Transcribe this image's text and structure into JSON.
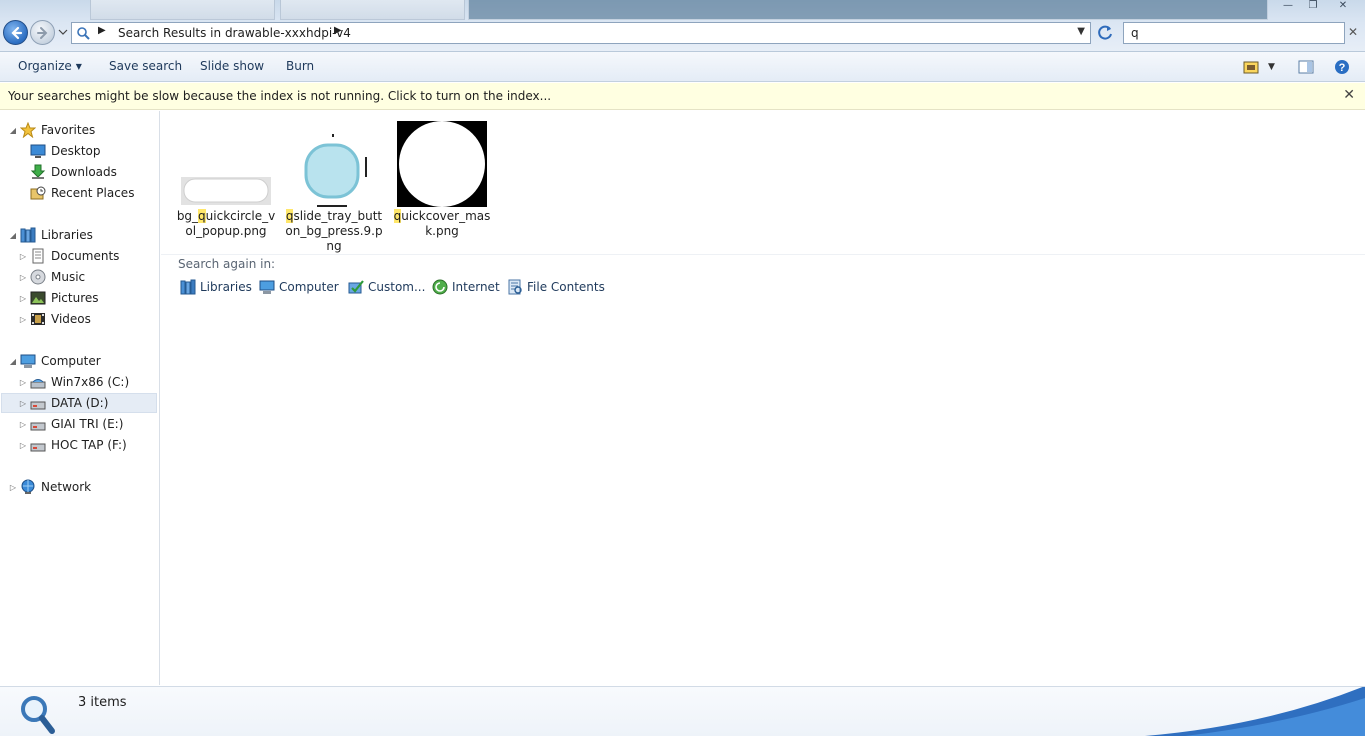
{
  "window": {
    "min_glyph": "—",
    "max_glyph": "❐",
    "close_glyph": "✕"
  },
  "address": {
    "breadcrumb": "Search Results in drawable-xxxhdpi-v4",
    "sep": "▶",
    "search_value": "q",
    "clear_glyph": "✕"
  },
  "toolbar": {
    "organize": "Organize",
    "save_search": "Save search",
    "slide_show": "Slide show",
    "burn": "Burn"
  },
  "infobar": {
    "message": "Your searches might be slow because the index is not running.  Click to turn on the index...",
    "close_glyph": "✕"
  },
  "nav": {
    "favorites": "Favorites",
    "desktop": "Desktop",
    "downloads": "Downloads",
    "recent_places": "Recent Places",
    "libraries": "Libraries",
    "documents": "Documents",
    "music": "Music",
    "pictures": "Pictures",
    "videos": "Videos",
    "computer": "Computer",
    "drive_c": "Win7x86 (C:)",
    "drive_d": "DATA (D:)",
    "drive_e": "GIAI TRI (E:)",
    "drive_f": "HOC TAP (F:)",
    "network": "Network"
  },
  "files": [
    {
      "pre": "bg_",
      "hl": "q",
      "post": "uickcircle_vol_popup.png"
    },
    {
      "pre": "",
      "hl": "q",
      "post": "slide_tray_button_bg_press.9.png"
    },
    {
      "pre": "",
      "hl": "q",
      "post": "uickcover_mask.png"
    }
  ],
  "search_again": {
    "label": "Search again in:",
    "libraries": "Libraries",
    "computer": "Computer",
    "custom": "Custom...",
    "internet": "Internet",
    "file_contents": "File Contents"
  },
  "details": {
    "count": "3 items"
  },
  "colors": {
    "accent": "#1e395b",
    "highlight": "#ffe76b",
    "infobar": "#ffffe1",
    "selected": "#e5ecf5"
  }
}
